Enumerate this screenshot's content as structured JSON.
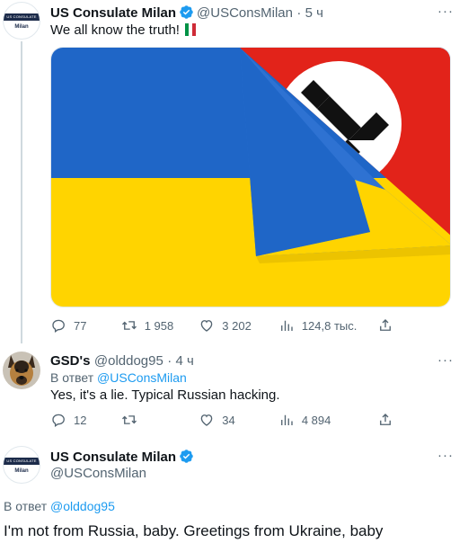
{
  "tweet1": {
    "name": "US Consulate Milan",
    "handle": "@USConsMilan",
    "time": "· 5 ч",
    "text": "We all know the truth!",
    "avatar_band_text": "US CONSULATE",
    "avatar_city": "Milan",
    "more": "···",
    "stats": {
      "replies": "77",
      "retweets": "1 958",
      "likes": "3 202",
      "views": "124,8 тыс."
    }
  },
  "reply1": {
    "name": "GSD's",
    "handle": "@olddog95",
    "time": "· 4 ч",
    "reply_prefix": "В ответ",
    "reply_to": "@USConsMilan",
    "text": "Yes, it's a lie. Typical Russian hacking.",
    "more": "···",
    "stats": {
      "replies": "12",
      "retweets": "",
      "likes": "34",
      "views": "4 894"
    }
  },
  "reply2": {
    "name": "US Consulate Milan",
    "handle": "@USConsMilan",
    "avatar_band_text": "US CONSULATE",
    "avatar_city": "Milan",
    "reply_prefix": "В ответ",
    "reply_to": "@olddog95",
    "text": "I'm not from Russia, baby. Greetings from Ukraine, baby",
    "more": "···"
  },
  "colors": {
    "verified": "#1d9bf0",
    "link": "#1d9bf0",
    "flag_blue": "#1f66c7",
    "flag_yellow": "#ffd400",
    "flag_red": "#e2231a"
  },
  "icons": [
    "verified-badge-icon",
    "reply-icon",
    "retweet-icon",
    "like-icon",
    "views-icon",
    "share-icon",
    "more-icon"
  ]
}
